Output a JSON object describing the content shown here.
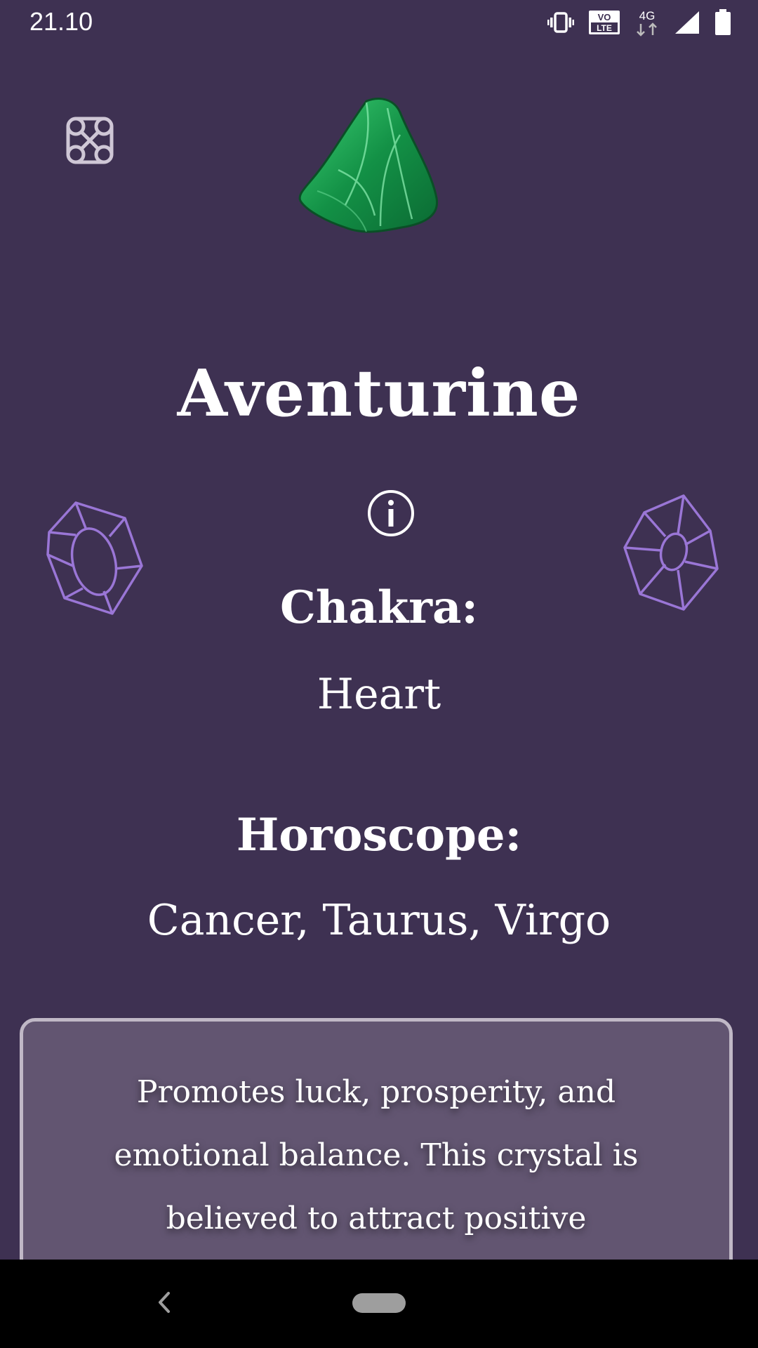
{
  "status_bar": {
    "time": "21.10",
    "icons": [
      "vibrate-icon",
      "volte-icon",
      "4g-data-icon",
      "signal-icon",
      "battery-icon"
    ],
    "volte_line1": "VO",
    "volte_line2": "LTE",
    "network": "4G"
  },
  "header": {
    "menu_icon": "celtic-knot-icon",
    "crystal_image": "aventurine-crystal-image"
  },
  "crystal": {
    "name": "Aventurine",
    "info_icon": "info-icon",
    "chakra_label": "Chakra:",
    "chakra_value": "Heart",
    "horoscope_label": "Horoscope:",
    "horoscope_value": "Cancer, Taurus, Virgo",
    "description": "Promotes luck, prosperity, and emotional balance. This crystal is believed to attract positive opportunities and enhance"
  },
  "decorations": {
    "left_gem_icon": "gem-outline-icon",
    "right_gem_icon": "gem-outline-icon"
  },
  "nav_bar": {
    "back_icon": "back-chevron-icon",
    "home_icon": "home-pill-icon"
  },
  "colors": {
    "background": "#3e3152",
    "card_background": "#625571",
    "card_border": "#c0b8c6",
    "gem_outline": "#9a76d6",
    "crystal_green": "#1f9a4f"
  }
}
